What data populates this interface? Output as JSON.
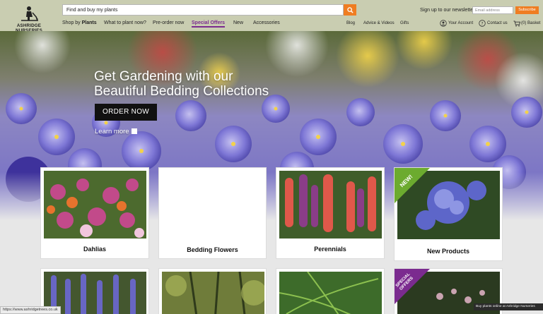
{
  "header": {
    "logo_text": "ASHRIDGE NURSERIES",
    "search_value": "Find and buy my plants",
    "newsletter_label": "Sign up to our newsletter",
    "email_placeholder": "Email address",
    "subscribe_label": "Subscribe",
    "nav": {
      "shop_prefix": "Shop by",
      "shop_bold": "Plants",
      "what_to_plant": "What to plant now?",
      "preorder": "Pre-order now",
      "special_offers": "Special Offers",
      "new": "New",
      "accessories": "Accessories",
      "blog": "Blog",
      "advice": "Advice & Videos",
      "gifts": "Gifts",
      "account": "Your Account",
      "contact": "Contact us",
      "basket": "(0) Basket"
    },
    "accent_color": "#ef7d22",
    "offer_color": "#7b2b8f"
  },
  "hero": {
    "title_line1": "Get Gardening with our",
    "title_line2": "Beautiful Bedding Collections",
    "cta": "ORDER NOW",
    "learn_more": "Learn more"
  },
  "cards": [
    {
      "label": "Dahlias"
    },
    {
      "label": "Bedding Flowers"
    },
    {
      "label": "Perennials"
    },
    {
      "label": "New Products",
      "badge": "NEW!"
    }
  ],
  "cards_row2": [
    {
      "label": ""
    },
    {
      "label": ""
    },
    {
      "label": ""
    },
    {
      "label": "",
      "badge_line1": "SPECIAL",
      "badge_line2": "OFFERS"
    }
  ],
  "status_url": "https://www.ashridgetrees.co.uk",
  "tooltip": "Buy plants online at Ashridge Nurseries"
}
